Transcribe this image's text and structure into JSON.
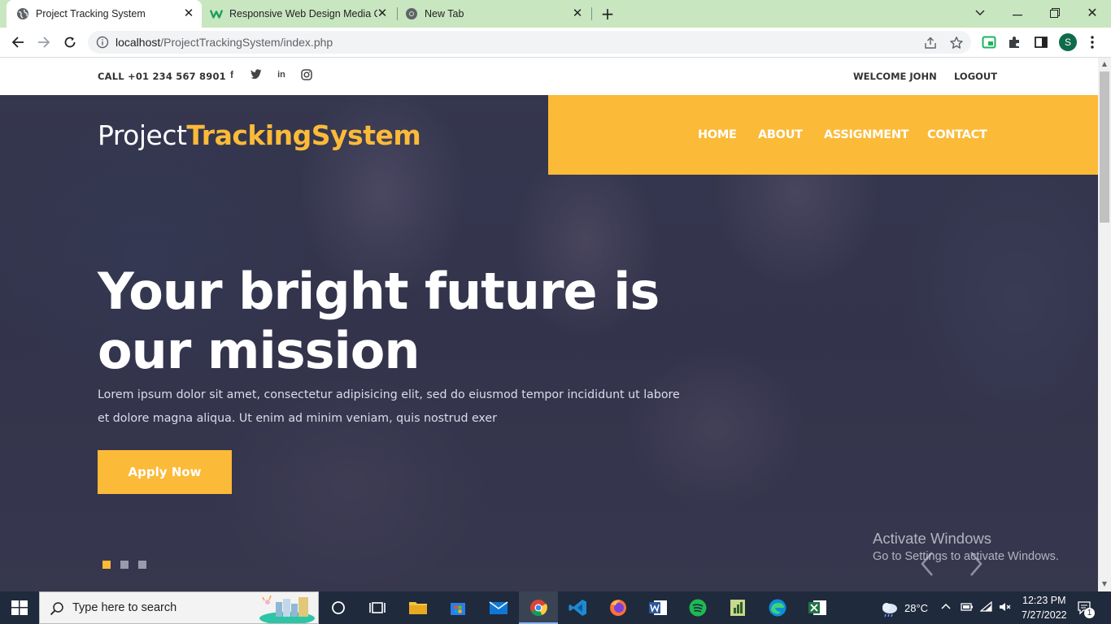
{
  "browser": {
    "tabs": [
      {
        "title": "Project Tracking System",
        "favicon": "globe-icon",
        "active": true
      },
      {
        "title": "Responsive Web Design Media Q",
        "favicon": "w-logo-icon",
        "active": false
      },
      {
        "title": "New Tab",
        "favicon": "chrome-icon",
        "active": false
      }
    ],
    "new_tab": "+",
    "url_host": "localhost",
    "url_path": "/ProjectTrackingSystem/index.php",
    "profile_initial": "S"
  },
  "topbar": {
    "call": "CALL +01 234 567 8901",
    "social": [
      "facebook-icon",
      "twitter-icon",
      "linkedin-icon",
      "instagram-icon"
    ],
    "welcome": "WELCOME JOHN",
    "logout": "LOGOUT"
  },
  "header": {
    "logo_plain": "Project",
    "logo_accent": "TrackingSystem",
    "nav": [
      "HOME",
      "ABOUT",
      "ASSIGNMENT",
      "CONTACT"
    ]
  },
  "hero": {
    "headline_line1": "Your bright future is",
    "headline_line2": "our mission",
    "lede": "Lorem ipsum dolor sit amet, consectetur adipisicing elit, sed do eiusmod tempor incididunt ut labore et dolore magna aliqua. Ut enim ad minim veniam, quis nostrud exer",
    "cta": "Apply Now",
    "slide_count": 3,
    "active_slide": 1
  },
  "watermark": {
    "line1": "Activate Windows",
    "line2": "Go to Settings to activate Windows."
  },
  "taskbar": {
    "search_placeholder": "Type here to search",
    "weather": "28°C",
    "time": "12:23 PM",
    "date": "7/27/2022",
    "notifications": "1"
  },
  "colors": {
    "accent": "#fbba38",
    "tabbar": "#c8e6c0",
    "taskbar": "#1f2a3c"
  }
}
